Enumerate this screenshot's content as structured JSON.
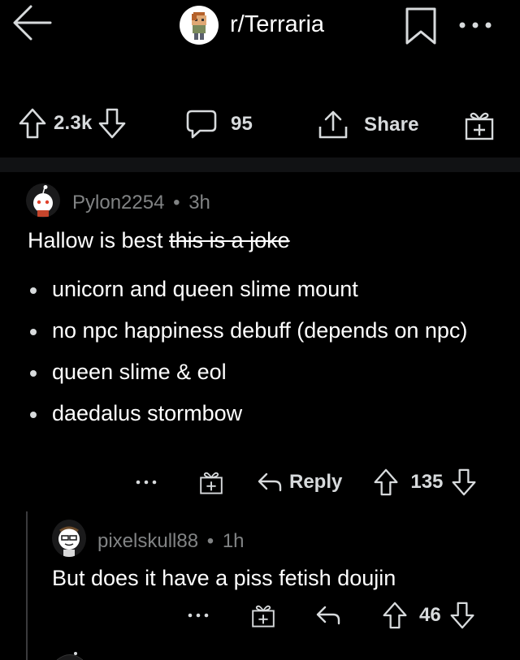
{
  "header": {
    "subreddit": "r/Terraria",
    "icons": [
      "back-arrow-icon",
      "bookmark-icon",
      "more-dots-icon"
    ]
  },
  "post_actions": {
    "upvotes": "2.3k",
    "comments": "95",
    "share_label": "Share",
    "icons": [
      "upvote-icon",
      "downvote-icon",
      "comment-icon",
      "share-icon",
      "award-icon"
    ]
  },
  "comments": [
    {
      "author": "Pylon2254",
      "separator": "•",
      "age": "3h",
      "text_main": "Hallow is best ",
      "text_struck": "this is a joke",
      "bullets": [
        "unicorn and queen slime mount",
        "no npc happiness debuff (depends on npc)",
        "queen slime & eol",
        "daedalus stormbow"
      ],
      "reply_label": "Reply",
      "score": "135"
    },
    {
      "author": "pixelskull88",
      "separator": "•",
      "age": "1h",
      "text": "But does it have a piss fetish doujin",
      "score": "46"
    }
  ],
  "colors": {
    "background": "#000000",
    "text": "#d7dadc",
    "meta": "#818384",
    "band": "#111214"
  }
}
